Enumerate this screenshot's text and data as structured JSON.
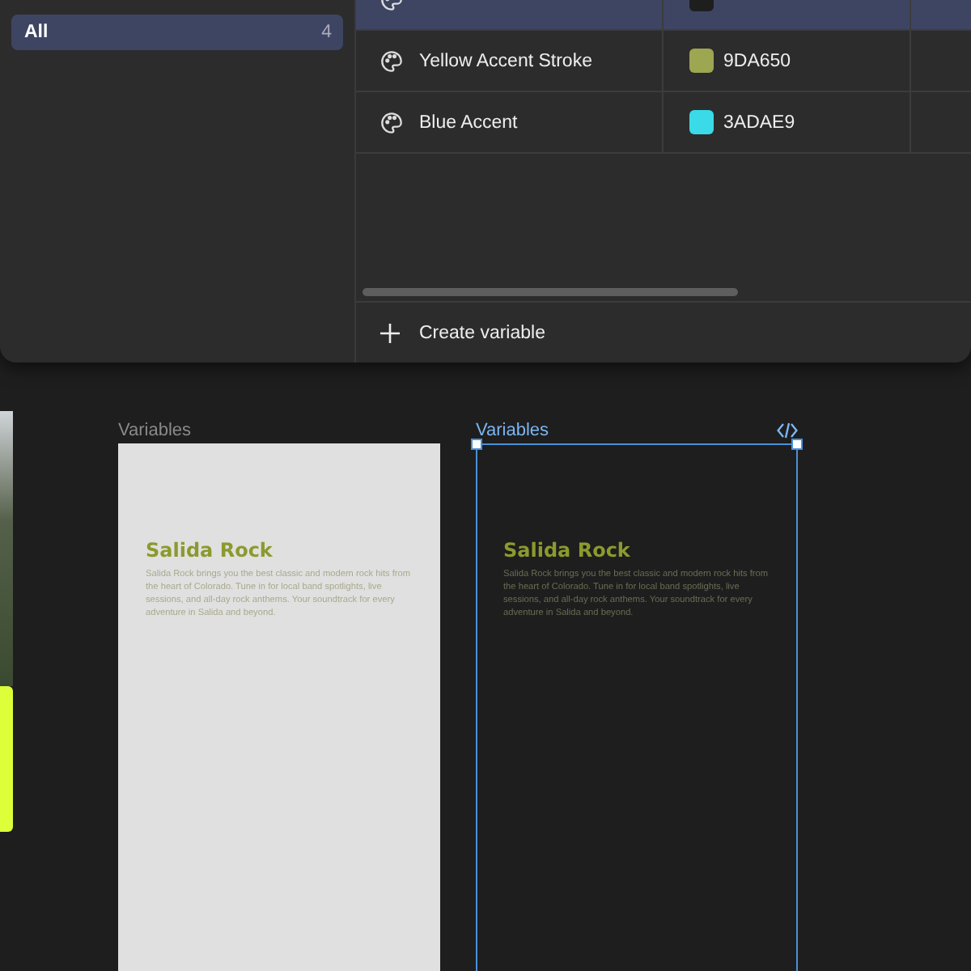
{
  "groups_panel": {
    "items": [
      {
        "label": "All",
        "count": "4",
        "selected": true
      }
    ]
  },
  "variables": {
    "rows": [
      {
        "color": "#1e1e1e",
        "selected": true
      },
      {
        "name": "Yellow Accent Stroke",
        "value": "9DA650",
        "color": "#9da650",
        "selected": false
      },
      {
        "name": "Blue Accent",
        "value": "3ADAE9",
        "color": "#3adae9",
        "selected": false
      }
    ],
    "create_label": "Create variable"
  },
  "canvas": {
    "frames": [
      {
        "label": "Variables",
        "kind": "light",
        "selected": false,
        "title": "Salida Rock",
        "body": "Salida Rock brings you the best classic and modern rock hits from the heart of Colorado. Tune in for local band spotlights, live sessions, and all-day rock anthems. Your soundtrack for every adventure in Salida and beyond."
      },
      {
        "label": "Variables",
        "kind": "dark",
        "selected": true,
        "title": "Salida Rock",
        "body": "Salida Rock brings you the best classic and modern rock hits from the heart of Colorado. Tune in for local band spotlights, live sessions, and all-day rock anthems. Your soundtrack for every adventure in Salida and beyond."
      }
    ]
  }
}
